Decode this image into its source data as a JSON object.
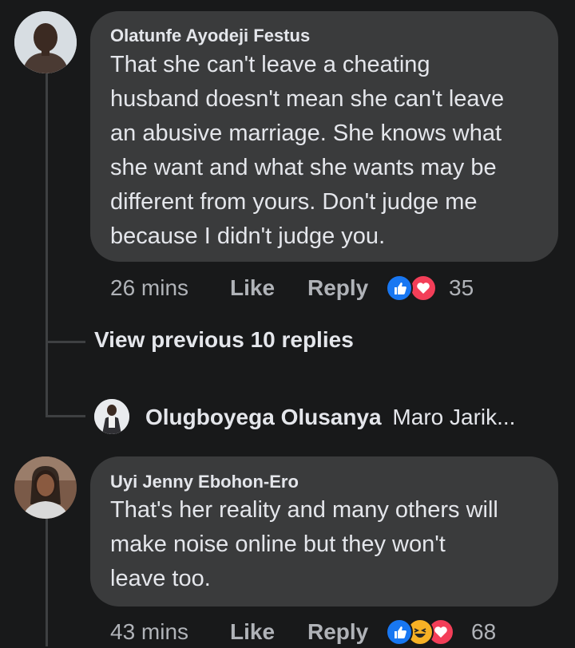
{
  "comment1": {
    "author": "Olatunfe Ayodeji Festus",
    "lines": [
      "That she can't leave a cheating",
      "husband doesn't mean she can't leave",
      "an abusive marriage. She knows what",
      "she want and what she wants may be",
      "different from yours. Don't judge me",
      "because I didn't judge you."
    ],
    "time": "26 mins",
    "like_label": "Like",
    "reply_label": "Reply",
    "reaction_count": "35",
    "reactions": [
      "like-icon",
      "love-icon"
    ]
  },
  "view_previous": "View previous 10 replies",
  "reply_preview": {
    "author": "Olugboyega Olusanya",
    "snippet": "Maro Jarik..."
  },
  "comment2": {
    "author": "Uyi Jenny Ebohon-Ero",
    "lines": [
      "That's her reality and many others will",
      "make noise online but they won't",
      "leave too."
    ],
    "time": "43 mins",
    "like_label": "Like",
    "reply_label": "Reply",
    "reaction_count": "68",
    "reactions": [
      "like-icon",
      "haha-icon",
      "love-icon"
    ]
  },
  "colors": {
    "background": "#18191a",
    "bubble": "#3a3b3c",
    "like_blue": "#1877f2",
    "love_red": "#f33e58",
    "haha_yellow": "#f7b125"
  }
}
